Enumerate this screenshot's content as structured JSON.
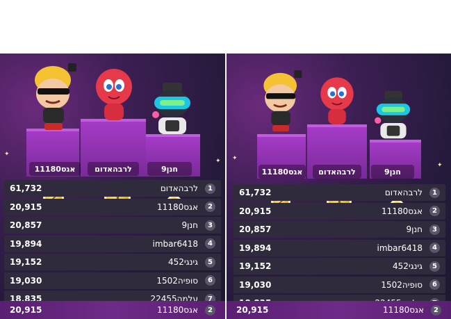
{
  "podium": {
    "first": {
      "name": "לרבהאדום",
      "medal": "1"
    },
    "second": {
      "name": "אגס11180",
      "medal": "2"
    },
    "third": {
      "name": "חנן9",
      "medal": "3"
    }
  },
  "leaderboard": [
    {
      "rank": "1",
      "name": "לרבהאדום",
      "score": "61,732"
    },
    {
      "rank": "2",
      "name": "אגס11180",
      "score": "20,915"
    },
    {
      "rank": "3",
      "name": "חנן9",
      "score": "20,857"
    },
    {
      "rank": "4",
      "name": "imbar6418",
      "score": "19,894"
    },
    {
      "rank": "5",
      "name": "גינגי452",
      "score": "19,152"
    },
    {
      "rank": "6",
      "name": "סופיה1502",
      "score": "19,030"
    },
    {
      "rank": "7",
      "name": "עלמה22455",
      "score": "18,835"
    }
  ],
  "current_user": {
    "rank": "2",
    "name": "אגס11180",
    "score": "20,915"
  },
  "colors": {
    "accent": "#a43bc6",
    "medal": "#f0b400",
    "row": "#2f2b3d",
    "highlight": "#6e2a88"
  }
}
